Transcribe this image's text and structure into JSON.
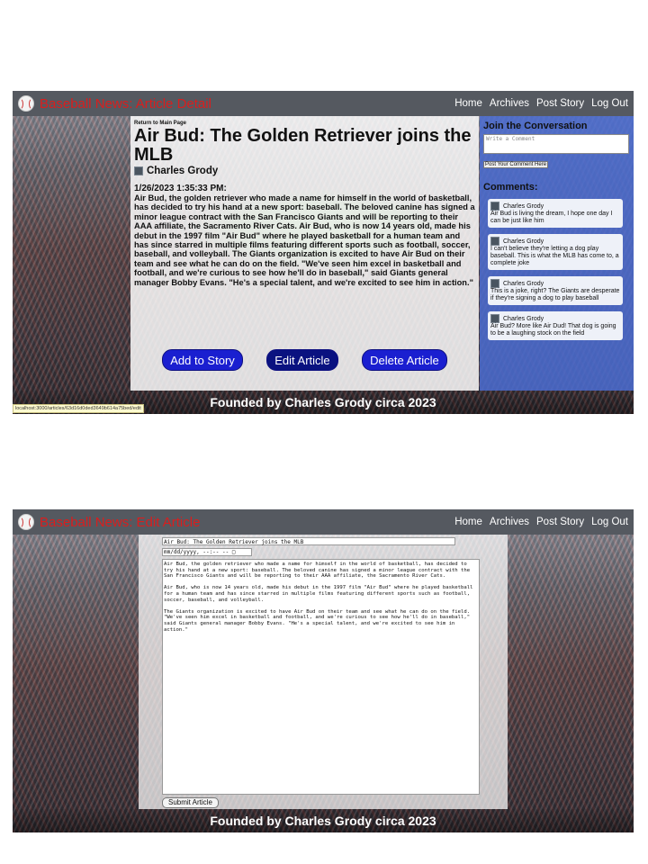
{
  "brand_accent": "#d91e1e",
  "button_blue": "#1a1fd0",
  "sidebar_blue": "#4a6cd2",
  "nav": {
    "links": [
      "Home",
      "Archives",
      "Post Story",
      "Log Out"
    ]
  },
  "footer": {
    "text": "Founded by Charles Grody circa 2023"
  },
  "detail": {
    "brand": "Baseball News: Article Detail",
    "back_link": "Return to Main Page",
    "title": "Air Bud: The Golden Retriever joins the MLB",
    "author": "Charles Grody",
    "date": "1/26/2023 1:35:33 PM:",
    "body": "Air Bud, the golden retriever who made a name for himself in the world of basketball, has decided to try his hand at a new sport: baseball. The beloved canine has signed a minor league contract with the San Francisco Giants and will be reporting to their AAA affiliate, the Sacramento River Cats. Air Bud, who is now 14 years old, made his debut in the 1997 film \"Air Bud\" where he played basketball for a human team and has since starred in multiple films featuring different sports such as football, soccer, baseball, and volleyball. The Giants organization is excited to have Air Bud on their team and see what he can do on the field. \"We've seen him excel in basketball and football, and we're curious to see how he'll do in baseball,\" said Giants general manager Bobby Evans. \"He's a special talent, and we're excited to see him in action.\"",
    "buttons": {
      "add": "Add to Story",
      "edit": "Edit Article",
      "delete": "Delete Article"
    },
    "sidebar": {
      "title": "Join the Conversation",
      "comment_placeholder": "Write a Comment",
      "post_button": "Post Your Comment Here",
      "comments_label": "Comments:",
      "comments": [
        {
          "author": "Charles Grody",
          "text": "Air Bud is living the dream, I hope one day I can be just like him"
        },
        {
          "author": "Charles Grody",
          "text": "I can't believe they're letting a dog play baseball. This is what the MLB has come to, a complete joke"
        },
        {
          "author": "Charles Grody",
          "text": "This is a joke, right? The Giants are desperate if they're signing a dog to play baseball"
        },
        {
          "author": "Charles Grody",
          "text": "Air Bud? More like Air Dud! That dog is going to be a laughing stock on the field"
        }
      ]
    },
    "status_url": "localhost:3000/articles/63d16d0ded3649b614a75bed/edit"
  },
  "edit": {
    "brand": "Baseball News: Edit Article",
    "title_value": "Air Bud: The Golden Retriever joins the MLB",
    "date_value": "mm/dd/yyyy, --:-- --",
    "body_value": "Air Bud, the golden retriever who made a name for himself in the world of basketball, has decided to try his hand at a new sport: baseball. The beloved canine has signed a minor league contract with the San Francisco Giants and will be reporting to their AAA affiliate, the Sacramento River Cats.\n\nAir Bud, who is now 14 years old, made his debut in the 1997 film \"Air Bud\" where he played basketball for a human team and has since starred in multiple films featuring different sports such as football, soccer, baseball, and volleyball.\n\nThe Giants organization is excited to have Air Bud on their team and see what he can do on the field. \"We've seen him excel in basketball and football, and we're curious to see how he'll do in baseball,\" said Giants general manager Bobby Evans. \"He's a special talent, and we're excited to see him in action.\"",
    "submit_button": "Submit Article"
  }
}
